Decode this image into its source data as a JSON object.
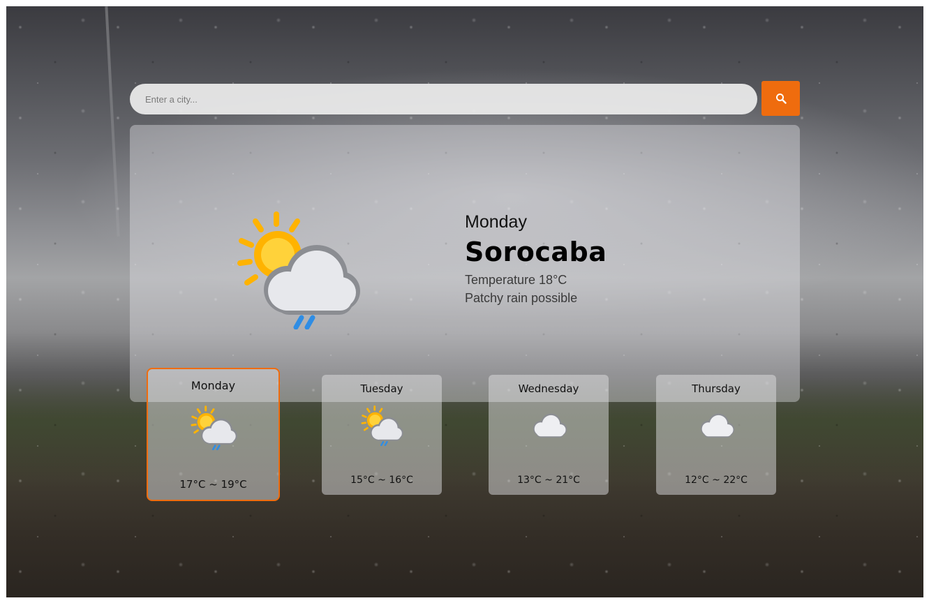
{
  "search": {
    "placeholder": "Enter a city...",
    "value": "",
    "button_icon": "search-icon"
  },
  "current": {
    "day": "Monday",
    "city": "Sorocaba",
    "temperature": "Temperature 18°C",
    "condition": "Patchy rain possible",
    "icon": "sun-cloud-rain-icon"
  },
  "forecast": [
    {
      "day": "Monday",
      "range": "17°C ~ 19°C",
      "icon": "sun-cloud-rain-icon",
      "selected": true
    },
    {
      "day": "Tuesday",
      "range": "15°C ~ 16°C",
      "icon": "sun-cloud-rain-icon",
      "selected": false
    },
    {
      "day": "Wednesday",
      "range": "13°C ~ 21°C",
      "icon": "cloud-icon",
      "selected": false
    },
    {
      "day": "Thursday",
      "range": "12°C ~ 22°C",
      "icon": "cloud-icon",
      "selected": false
    }
  ],
  "colors": {
    "accent": "#ef6c0e",
    "sun": "#ffb300",
    "rain": "#2f8de4"
  }
}
